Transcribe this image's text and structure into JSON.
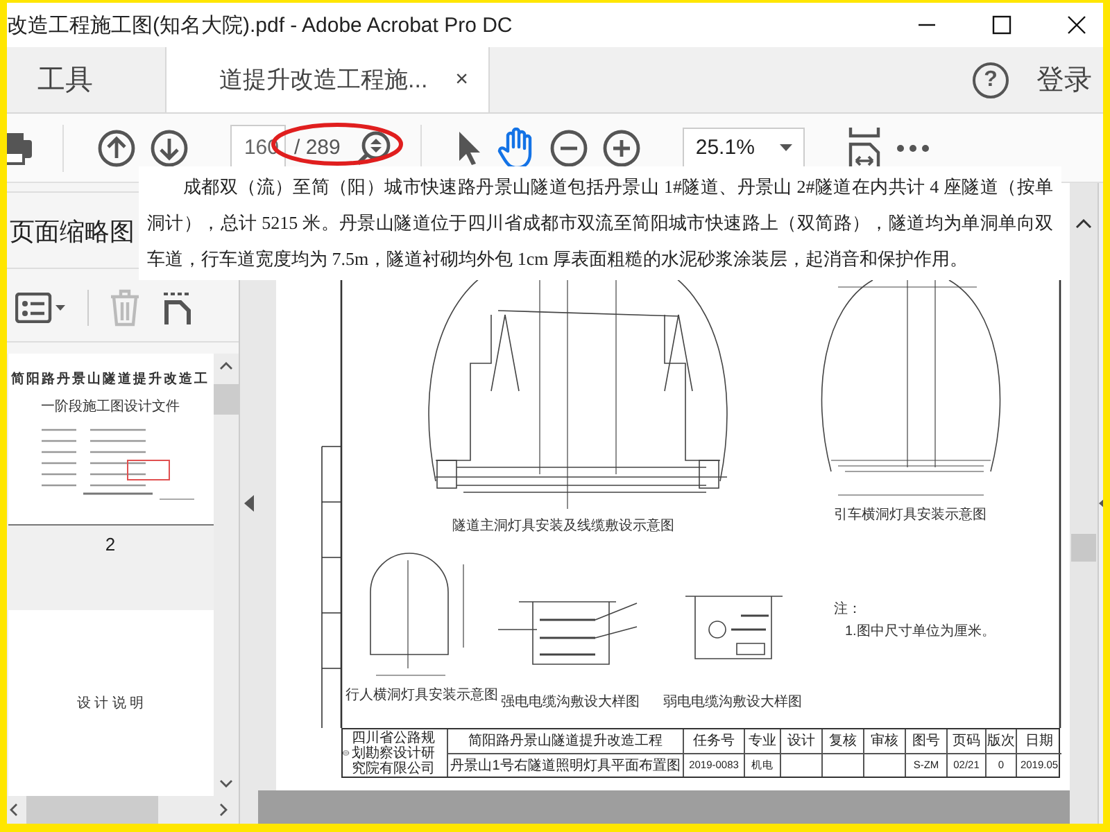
{
  "window": {
    "title": "改造工程施工图(知名大院).pdf - Adobe Acrobat Pro DC"
  },
  "tabs": [
    {
      "label": "工具",
      "selected": false
    },
    {
      "label": "道提升改造工程施...",
      "selected": true,
      "close": "×"
    }
  ],
  "header": {
    "help": "?",
    "login": "登录"
  },
  "toolbar": {
    "page_number": "160",
    "page_total": "/ 289",
    "zoom": "25.1%"
  },
  "overlay_text": "成都双（流）至简（阳）城市快速路丹景山隧道包括丹景山 1#隧道、丹景山 2#隧道在内共计 4 座隧道（按单洞计），总计 5215 米。丹景山隧道位于四川省成都市双流至简阳城市快速路上（双简路），隧道均为单洞单向双车道，行车道宽度均为 7.5m，隧道衬砌均外包 1cm 厚表面粗糙的水泥砂浆涂装层，起消音和保护作用。",
  "sidebar": {
    "title": "页面缩略图",
    "thumbnails": [
      {
        "lines": [
          "简阳路丹景山隧道提升改造工",
          "一阶段施工图设计文件"
        ],
        "page": "2"
      },
      {
        "lines": [
          "设 计 说 明"
        ]
      }
    ]
  },
  "drawing": {
    "captions": [
      "隧道主洞灯具安装及线缆敷设示意图",
      "引车横洞灯具安装示意图",
      "行人横洞灯具安装示意图",
      "强电电缆沟敷设大样图",
      "弱电电缆沟敷设大样图"
    ],
    "notes": [
      "注：",
      "1.图中尺寸单位为厘米。"
    ],
    "title_block": {
      "company": "四川省公路规划勘察设计研究院有限公司",
      "project": "简阳路丹景山隧道提升改造工程",
      "sheet": "丹景山1号右隧道照明灯具平面布置图",
      "cells": [
        {
          "header": "任务号",
          "value": "2019-0083"
        },
        {
          "header": "专业",
          "value": "机电"
        },
        {
          "header": "设计"
        },
        {
          "header": "复核"
        },
        {
          "header": "审核"
        },
        {
          "header": "图号",
          "value": "S-ZM"
        },
        {
          "header": "页码",
          "value": "02/21"
        },
        {
          "header": "版次",
          "value": "0"
        },
        {
          "header": "日期",
          "value": "2019.05"
        }
      ]
    }
  }
}
